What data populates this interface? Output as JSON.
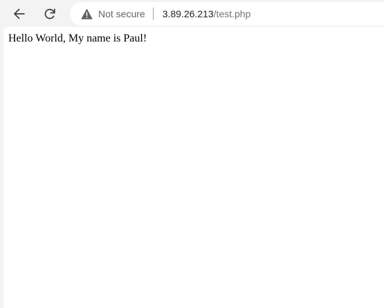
{
  "toolbar": {
    "back_icon": "arrow-left-icon",
    "reload_icon": "reload-icon",
    "security": {
      "icon": "warning-triangle-icon",
      "label": "Not secure"
    },
    "url": {
      "host": "3.89.26.213",
      "path": "/test.php"
    }
  },
  "page": {
    "text": "Hello World, My name is Paul!"
  },
  "colors": {
    "chrome_background": "#f3f3f3",
    "omnibox_background": "#ffffff",
    "secondary_text": "#5f6368",
    "url_host_text": "#202124",
    "page_background": "#ffffff"
  }
}
